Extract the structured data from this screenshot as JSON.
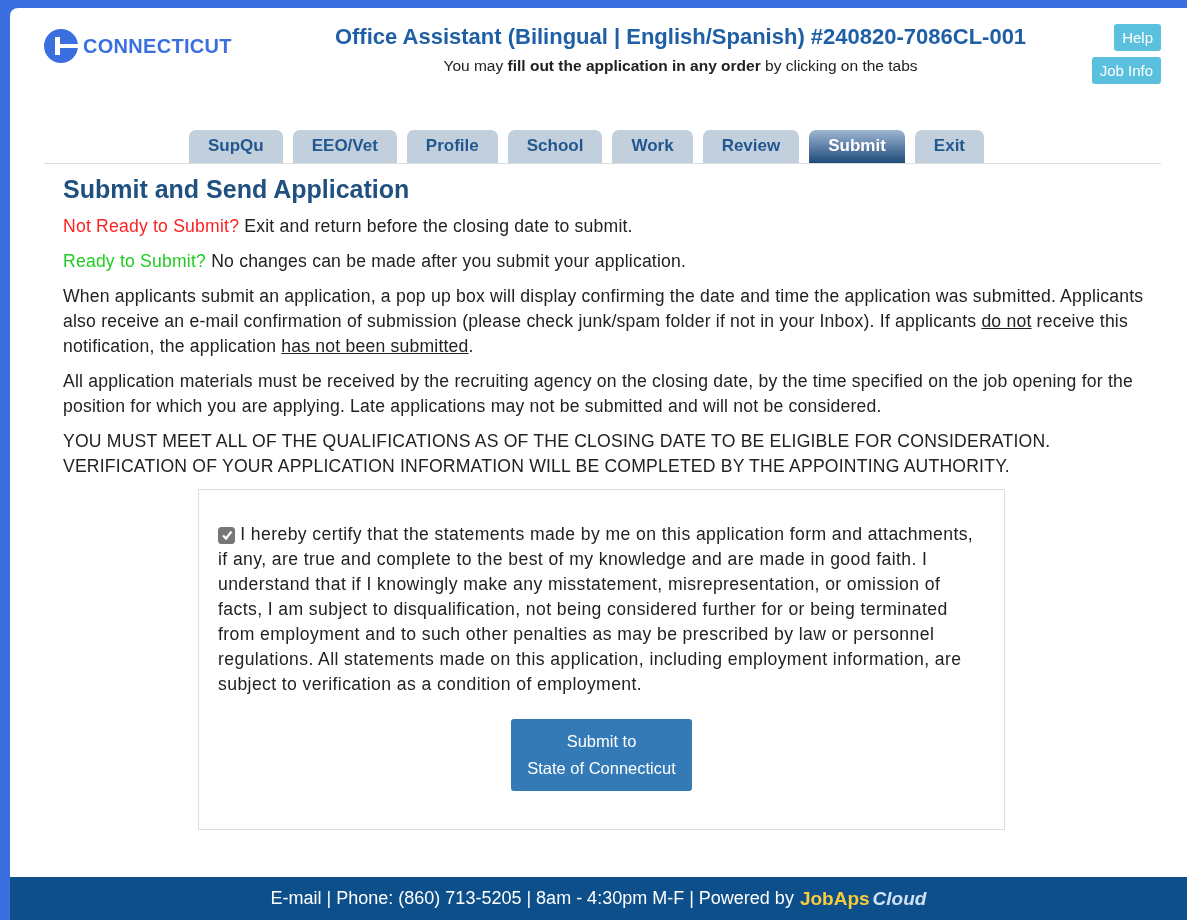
{
  "logo": {
    "text": "CONNECTICUT"
  },
  "header": {
    "title": "Office Assistant (Bilingual | English/Spanish) #240820-7086CL-001",
    "subtitle": [
      {
        "text": "You may ",
        "bold": false
      },
      {
        "text": "fill out the application in any order",
        "bold": true
      },
      {
        "text": " by clicking on the tabs",
        "bold": false
      }
    ]
  },
  "header_buttons": [
    "Help",
    "Job Info"
  ],
  "tabs": [
    {
      "label": "SupQu",
      "selected": false
    },
    {
      "label": "EEO/Vet",
      "selected": false
    },
    {
      "label": "Profile",
      "selected": false
    },
    {
      "label": "School",
      "selected": false
    },
    {
      "label": "Work",
      "selected": false
    },
    {
      "label": "Review",
      "selected": false
    },
    {
      "label": "Submit",
      "selected": true
    },
    {
      "label": "Exit",
      "selected": false
    }
  ],
  "heading": "Submit and Send Application",
  "notices": [
    {
      "kind": "not_ready",
      "lead": "Not Ready to Submit?",
      "text": " Exit and return before the closing date to submit."
    },
    {
      "kind": "ready",
      "lead": "Ready to Submit?",
      "text": " No changes can be made after you submit your application."
    }
  ],
  "paragraphs": [
    [
      {
        "text": "When applicants submit an application, a pop up box will display confirming the date and time the application was submitted. Applicants also receive an e-mail confirmation of submission (please check junk/spam folder if not in your Inbox). If applicants ",
        "underline": false
      },
      {
        "text": "do not",
        "underline": true
      },
      {
        "text": " receive this notification, the application ",
        "underline": false
      },
      {
        "text": "has not been submitted",
        "underline": true
      },
      {
        "text": ".",
        "underline": false
      }
    ],
    [
      {
        "text": "All application materials must be received by the recruiting agency on the closing date, by the time specified on the job opening for the position for which you are applying. Late applications may not be submitted and will not be considered.",
        "underline": false
      }
    ],
    [
      {
        "text": "YOU MUST MEET ALL OF THE QUALIFICATIONS AS OF THE CLOSING DATE TO BE ELIGIBLE FOR CONSIDERATION. VERIFICATION OF YOUR APPLICATION INFORMATION WILL BE COMPLETED BY THE APPOINTING AUTHORITY.",
        "underline": false
      }
    ]
  ],
  "certification": {
    "checked": true,
    "text": "I hereby certify that the statements made by me on this application form and attachments, if any, are true and complete to the best of my knowledge and are made in good faith. I understand that if I knowingly make any misstatement, misrepresentation, or omission of facts, I am subject to disqualification, not being considered further for or being terminated from employment and to such other penalties as may be prescribed by law or personnel regulations. All statements made on this application, including employment information, are subject to verification as a condition of employment."
  },
  "submit_button": [
    "Submit to",
    "State of Connecticut"
  ],
  "footer": {
    "text": "E-mail | Phone: (860) 713-5205 | 8am - 4:30pm M-F | Powered by",
    "logo": [
      "JobAps",
      "Cloud"
    ]
  }
}
